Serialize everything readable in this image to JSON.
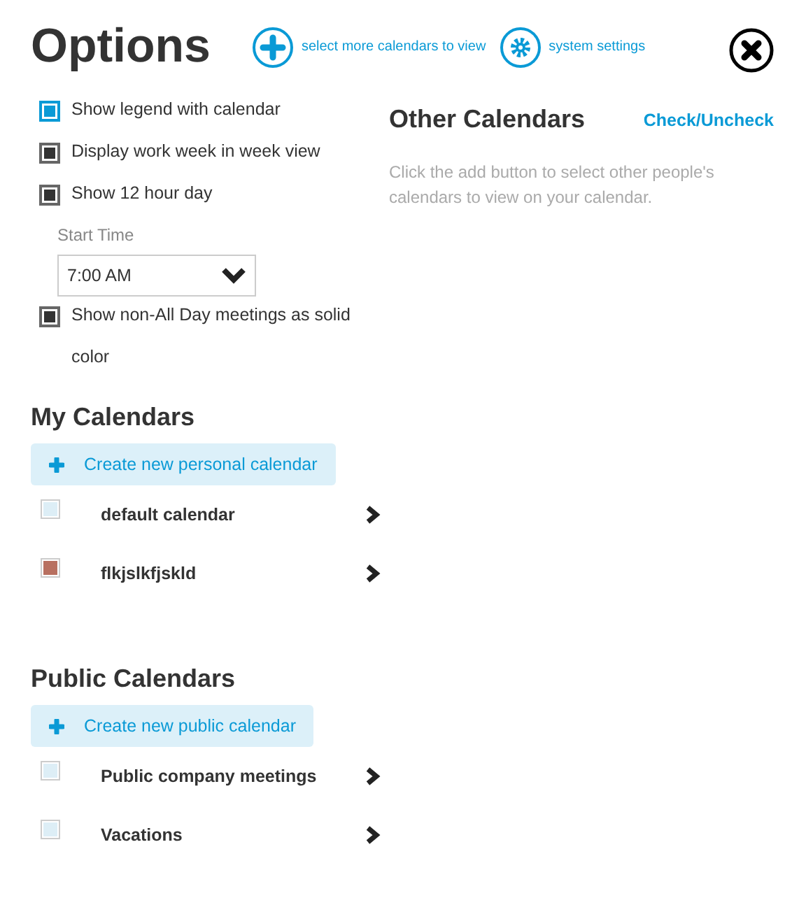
{
  "header": {
    "title": "Options",
    "links": [
      {
        "kind": "add",
        "label": "select more calendars to view"
      },
      {
        "kind": "settings",
        "label": "system settings"
      }
    ]
  },
  "options": [
    {
      "label": "Show legend with calendar",
      "checked": true
    },
    {
      "label": "Display work week in week view",
      "checked": false
    },
    {
      "label": "Show 12 hour day",
      "checked": false
    },
    {
      "label": "Show non-All Day meetings as solid color",
      "checked": false
    }
  ],
  "start_time": {
    "label": "Start Time",
    "value": "7:00 AM"
  },
  "sections": [
    {
      "title": "My Calendars",
      "create_label": "Create new personal calendar",
      "calendars": [
        {
          "name": "default calendar",
          "color": "#ddeef6"
        },
        {
          "name": "flkjslkfjskld",
          "color": "#b87060"
        }
      ]
    },
    {
      "title": "Public Calendars",
      "create_label": "Create new public calendar",
      "calendars": [
        {
          "name": "Public company meetings",
          "color": "#ddeef6"
        },
        {
          "name": "Vacations",
          "color": "#ddeef6"
        }
      ]
    }
  ],
  "other": {
    "title": "Other Calendars",
    "action": "Check/Uncheck",
    "hint": "Click the add button to select other people's calendars to view on your calendar."
  }
}
